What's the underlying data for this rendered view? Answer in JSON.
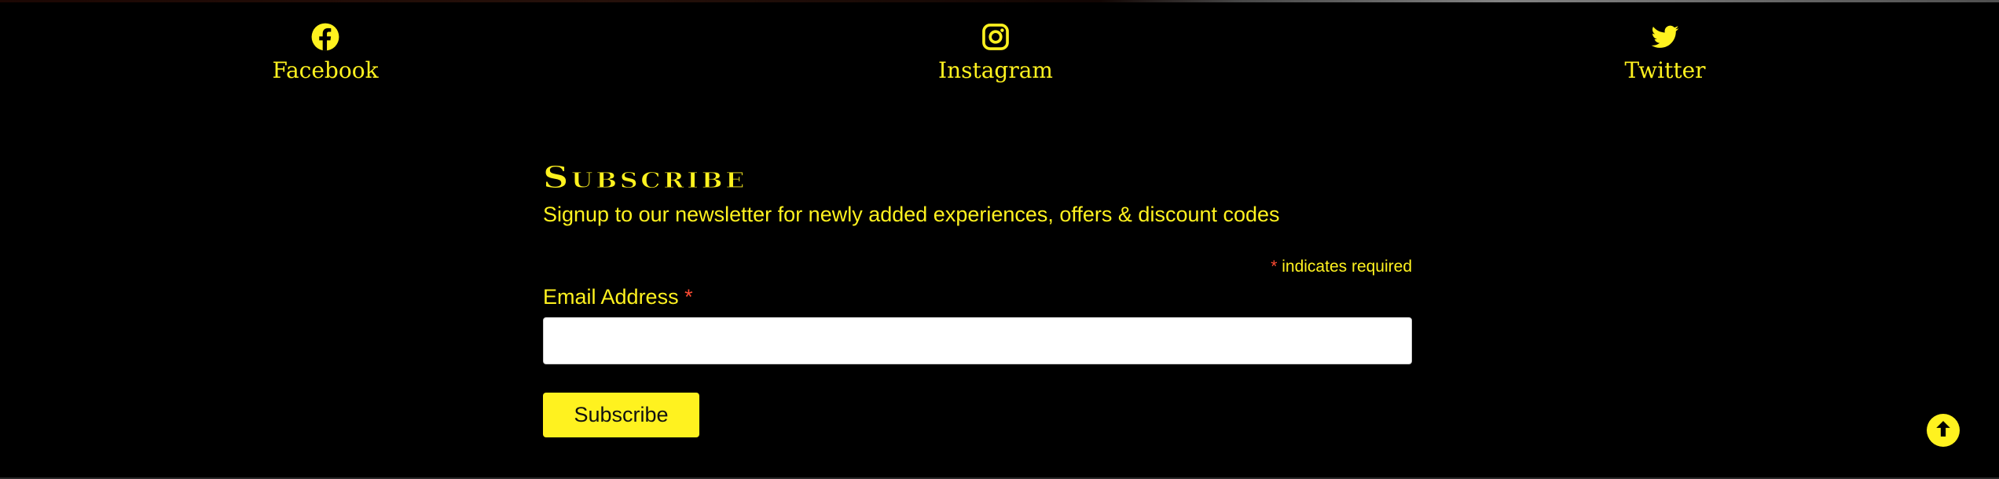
{
  "colors": {
    "background": "#000000",
    "accent": "#fff21f",
    "required": "#ff4b33",
    "input_background": "#ffffff"
  },
  "social": [
    {
      "label": "Facebook",
      "icon": "facebook-icon"
    },
    {
      "label": "Instagram",
      "icon": "instagram-icon"
    },
    {
      "label": "Twitter",
      "icon": "twitter-icon"
    }
  ],
  "subscribe": {
    "title": "Subscribe",
    "description": "Signup to our newsletter for newly added experiences, offers & discount codes",
    "required_mark": "*",
    "required_note": "indicates required",
    "email_label": "Email Address",
    "email_value": "",
    "button_label": "Subscribe"
  },
  "scroll_top": {
    "icon": "arrow-up-icon"
  }
}
